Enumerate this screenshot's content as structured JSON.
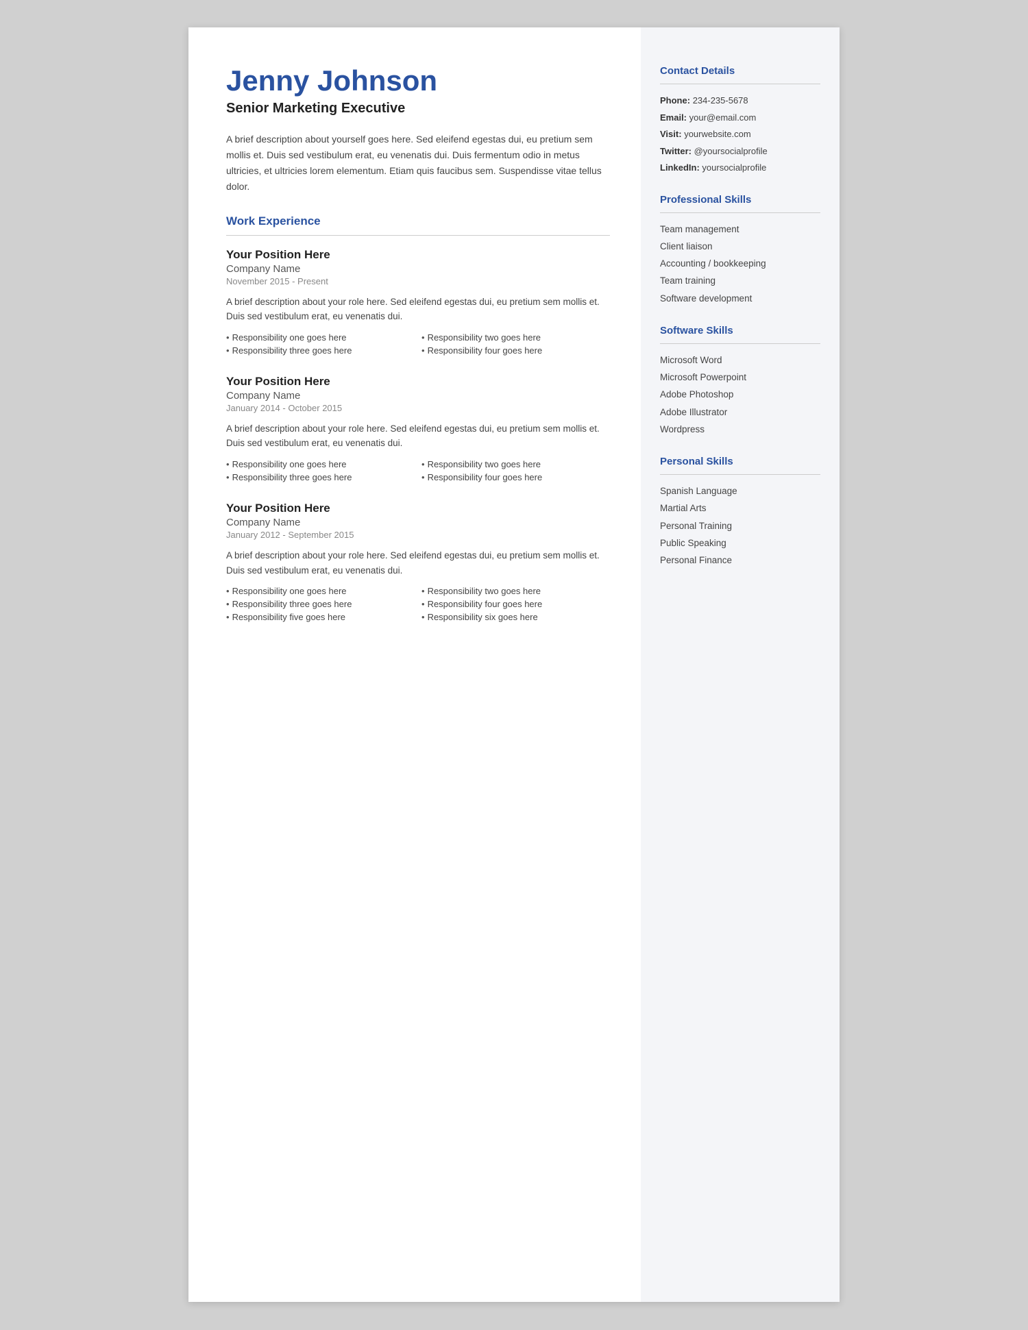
{
  "header": {
    "name": "Jenny Johnson",
    "job_title": "Senior Marketing Executive",
    "bio": "A brief description about yourself goes here. Sed eleifend egestas dui, eu pretium sem mollis et. Duis sed vestibulum erat, eu venenatis dui. Duis fermentum odio in metus ultricies, et ultricies lorem elementum. Etiam quis faucibus sem. Suspendisse vitae tellus dolor."
  },
  "sections": {
    "work_experience_label": "Work Experience"
  },
  "jobs": [
    {
      "position": "Your Position Here",
      "company": "Company Name",
      "dates": "November 2015 - Present",
      "description": "A brief description about your role here. Sed eleifend egestas dui, eu pretium sem mollis et. Duis sed vestibulum erat, eu venenatis dui.",
      "responsibilities": [
        "Responsibility one goes here",
        "Responsibility two goes here",
        "Responsibility three goes here",
        "Responsibility four goes here"
      ]
    },
    {
      "position": "Your Position Here",
      "company": "Company Name",
      "dates": "January 2014 - October 2015",
      "description": "A brief description about your role here. Sed eleifend egestas dui, eu pretium sem mollis et. Duis sed vestibulum erat, eu venenatis dui.",
      "responsibilities": [
        "Responsibility one goes here",
        "Responsibility two goes here",
        "Responsibility three goes here",
        "Responsibility four goes here"
      ]
    },
    {
      "position": "Your Position Here",
      "company": "Company Name",
      "dates": "January 2012 - September 2015",
      "description": "A brief description about your role here. Sed eleifend egestas dui, eu pretium sem mollis et. Duis sed vestibulum erat, eu venenatis dui.",
      "responsibilities": [
        "Responsibility one goes here",
        "Responsibility two goes here",
        "Responsibility three goes here",
        "Responsibility four goes here",
        "Responsibility five goes here",
        "Responsibility six goes here"
      ]
    }
  ],
  "sidebar": {
    "contact_details_label": "Contact Details",
    "contact": {
      "phone_label": "Phone:",
      "phone": "234-235-5678",
      "email_label": "Email:",
      "email": "your@email.com",
      "visit_label": "Visit:",
      "visit": "yourwebsite.com",
      "twitter_label": "Twitter:",
      "twitter": "@yoursocialprofile",
      "linkedin_label": "LinkedIn:",
      "linkedin": "yoursocialprofile"
    },
    "professional_skills_label": "Professional Skills",
    "professional_skills": [
      "Team management",
      "Client liaison",
      "Accounting / bookkeeping",
      "Team training",
      "Software development"
    ],
    "software_skills_label": "Software Skills",
    "software_skills": [
      "Microsoft Word",
      "Microsoft Powerpoint",
      "Adobe Photoshop",
      "Adobe Illustrator",
      "Wordpress"
    ],
    "personal_skills_label": "Personal Skills",
    "personal_skills": [
      "Spanish Language",
      "Martial Arts",
      "Personal Training",
      "Public Speaking",
      "Personal Finance"
    ]
  }
}
